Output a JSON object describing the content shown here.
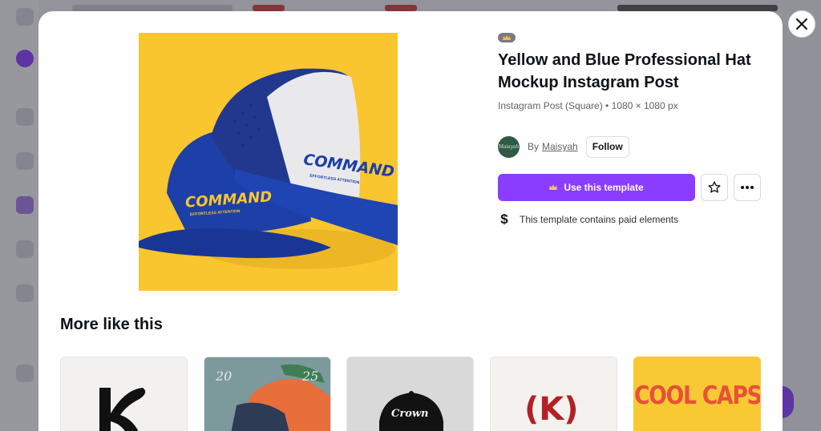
{
  "modal": {
    "pro_icon": "crown-icon",
    "title": "Yellow and Blue Professional Hat Mockup Instagram Post",
    "subtitle": "Instagram Post (Square) • 1080 × 1080 px",
    "author": {
      "by_label": "By",
      "name": "Maisyah",
      "avatar_text": "Maisyah",
      "follow_label": "Follow"
    },
    "actions": {
      "use_label": "Use this template",
      "star_icon": "star-icon",
      "more_icon": "more-icon"
    },
    "paid_notice": {
      "icon": "dollar-icon",
      "text": "This template contains paid elements"
    },
    "preview": {
      "brand_text": "COMMAND",
      "tagline": "EFFORTLESS ATTENTION"
    },
    "more_like_this": {
      "heading": "More like this",
      "items": [
        {
          "alt": "letter-k-template",
          "text": ""
        },
        {
          "alt": "photo-template",
          "text": "20",
          "text2": "25"
        },
        {
          "alt": "black-cap-template",
          "text": "Crown"
        },
        {
          "alt": "red-k-template",
          "text": "(K)"
        },
        {
          "alt": "cool-caps-template",
          "text": "COOL CAPS"
        }
      ]
    }
  },
  "colors": {
    "accent": "#8b3dff",
    "preview_bg": "#fac62f",
    "cap_blue": "#1d3fa8"
  }
}
